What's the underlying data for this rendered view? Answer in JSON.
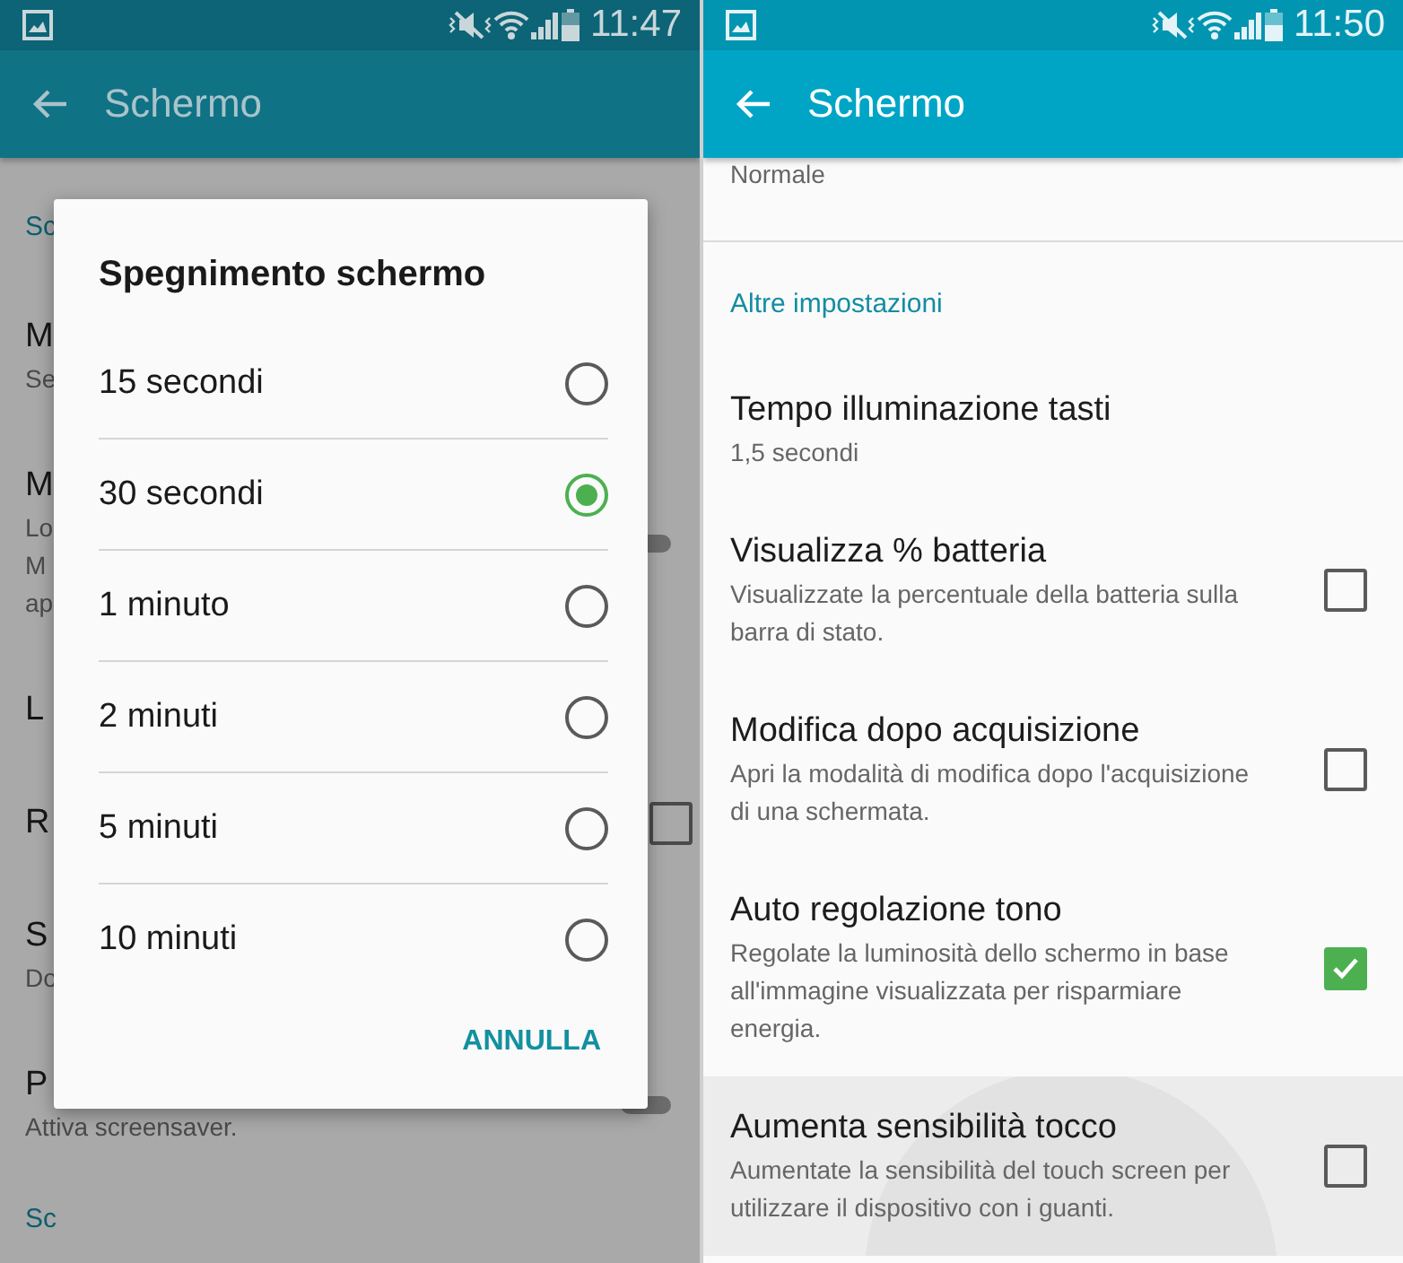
{
  "left_screen": {
    "status_bar": {
      "time": "11:47"
    },
    "app_bar": {
      "title": "Schermo"
    },
    "background_items": [
      {
        "kind": "section",
        "title": "Sc"
      },
      {
        "kind": "plain",
        "title": "M",
        "summary_lines": [
          "Se"
        ]
      },
      {
        "kind": "switch",
        "title": "M",
        "summary_lines": [
          "Lo",
          "M",
          "ap"
        ],
        "on": false
      },
      {
        "kind": "plain",
        "title": "L"
      },
      {
        "kind": "checkbox",
        "title": "R",
        "checked": false
      },
      {
        "kind": "plain",
        "title": "S",
        "summary_lines": [
          "Do"
        ]
      },
      {
        "kind": "switch",
        "title": "P",
        "summary_lines": [
          "Attiva screensaver."
        ],
        "on": false
      },
      {
        "kind": "section",
        "title": "Sc"
      }
    ],
    "dialog": {
      "title": "Spegnimento schermo",
      "options": [
        {
          "label": "15 secondi",
          "selected": false
        },
        {
          "label": "30 secondi",
          "selected": true
        },
        {
          "label": "1 minuto",
          "selected": false
        },
        {
          "label": "2 minuti",
          "selected": false
        },
        {
          "label": "5 minuti",
          "selected": false
        },
        {
          "label": "10 minuti",
          "selected": false
        }
      ],
      "button": "ANNULLA"
    }
  },
  "right_screen": {
    "status_bar": {
      "time": "11:50"
    },
    "app_bar": {
      "title": "Schermo"
    },
    "items": [
      {
        "kind": "value",
        "summary_lines": [
          "Normale"
        ]
      },
      {
        "kind": "section",
        "title": "Altre impostazioni"
      },
      {
        "kind": "value",
        "title": "Tempo illuminazione tasti",
        "summary_lines": [
          "1,5 secondi"
        ]
      },
      {
        "kind": "checkbox",
        "title": "Visualizza % batteria",
        "summary_lines": [
          "Visualizzate la percentuale della batteria sulla",
          "barra di stato."
        ],
        "checked": false,
        "pressed": false
      },
      {
        "kind": "checkbox",
        "title": "Modifica dopo acquisizione",
        "summary_lines": [
          "Apri la modalità di modifica dopo l'acquisizione",
          "di una schermata."
        ],
        "checked": false,
        "pressed": false
      },
      {
        "kind": "checkbox",
        "title": "Auto regolazione tono",
        "summary_lines": [
          "Regolate la luminosità dello schermo in base",
          "all'immagine visualizzata per risparmiare",
          "energia."
        ],
        "checked": true,
        "pressed": false
      },
      {
        "kind": "checkbox",
        "title": "Aumenta sensibilità tocco",
        "summary_lines": [
          "Aumentate la sensibilità del touch screen per",
          "utilizzare il dispositivo con i guanti."
        ],
        "checked": false,
        "pressed": true
      }
    ]
  }
}
